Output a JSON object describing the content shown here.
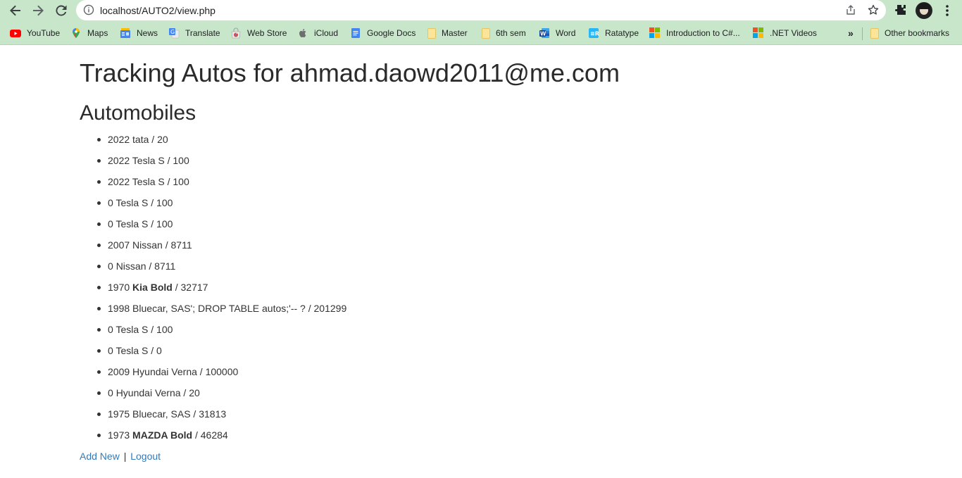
{
  "browser": {
    "url": "localhost/AUTO2/view.php",
    "bookmarks": [
      {
        "label": "YouTube",
        "icon": "youtube-icon"
      },
      {
        "label": "Maps",
        "icon": "maps-icon"
      },
      {
        "label": "News",
        "icon": "news-icon"
      },
      {
        "label": "Translate",
        "icon": "translate-icon"
      },
      {
        "label": "Web Store",
        "icon": "web-store-icon"
      },
      {
        "label": "iCloud",
        "icon": "apple-icon"
      },
      {
        "label": "Google Docs",
        "icon": "docs-icon"
      },
      {
        "label": "Master",
        "icon": "folder-icon"
      },
      {
        "label": "6th sem",
        "icon": "folder-icon"
      },
      {
        "label": "Word",
        "icon": "word-icon"
      },
      {
        "label": "Ratatype",
        "icon": "ratatype-icon"
      },
      {
        "label": "Introduction to C#...",
        "icon": "microsoft-icon"
      },
      {
        "label": ".NET Videos",
        "icon": "microsoft-icon"
      }
    ],
    "overflow_label": "»",
    "other_bookmarks": "Other bookmarks",
    "colors": {
      "chrome": "#c8e6c9",
      "link": "#337ab7"
    }
  },
  "page": {
    "title": "Tracking Autos for ahmad.daowd2011@me.com",
    "subtitle": "Automobiles",
    "autos": [
      {
        "year": "2022",
        "make": "tata",
        "mileage": "20",
        "bold": false
      },
      {
        "year": "2022",
        "make": "Tesla S",
        "mileage": "100",
        "bold": false
      },
      {
        "year": "2022",
        "make": "Tesla S",
        "mileage": "100",
        "bold": false
      },
      {
        "year": "0",
        "make": "Tesla S",
        "mileage": "100",
        "bold": false
      },
      {
        "year": "0",
        "make": "Tesla S",
        "mileage": "100",
        "bold": false
      },
      {
        "year": "2007",
        "make": "Nissan",
        "mileage": "8711",
        "bold": false
      },
      {
        "year": "0",
        "make": "Nissan",
        "mileage": "8711",
        "bold": false
      },
      {
        "year": "1970",
        "make": "Kia Bold",
        "mileage": "32717",
        "bold": true
      },
      {
        "year": "1998",
        "make": "Bluecar, SAS'; DROP TABLE autos;'-- ?",
        "mileage": "201299",
        "bold": false
      },
      {
        "year": "0",
        "make": "Tesla S",
        "mileage": "100",
        "bold": false
      },
      {
        "year": "0",
        "make": "Tesla S",
        "mileage": "0",
        "bold": false
      },
      {
        "year": "2009",
        "make": "Hyundai Verna",
        "mileage": "100000",
        "bold": false
      },
      {
        "year": "0",
        "make": "Hyundai Verna",
        "mileage": "20",
        "bold": false
      },
      {
        "year": "1975",
        "make": "Bluecar, SAS",
        "mileage": "31813",
        "bold": false
      },
      {
        "year": "1973",
        "make": "MAZDA Bold",
        "mileage": "46284",
        "bold": true
      }
    ],
    "add_new": "Add New",
    "separator": "|",
    "logout": "Logout"
  }
}
